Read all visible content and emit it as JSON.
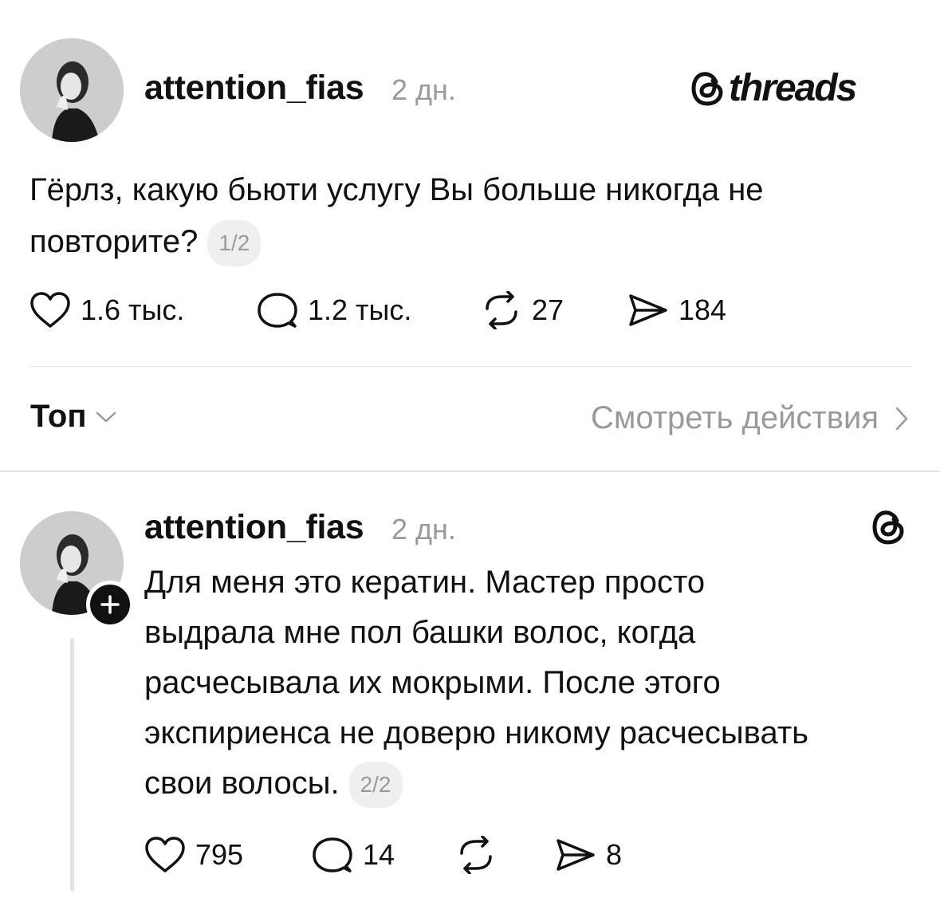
{
  "brand": {
    "wordmark": "threads",
    "icon": "threads-icon"
  },
  "post": {
    "username": "attention_fias",
    "time": "2 дн.",
    "text": "Гёрлз, какую бьюти услугу Вы больше никогда не повторите?",
    "page_badge": "1/2",
    "actions": {
      "likes": "1.6 тыс.",
      "replies": "1.2 тыс.",
      "reposts": "27",
      "shares": "184"
    }
  },
  "sort_bar": {
    "sort_label": "Топ",
    "view_activity_label": "Смотреть действия"
  },
  "reply": {
    "username": "attention_fias",
    "time": "2 дн.",
    "text": "Для меня это кератин. Мастер просто выдрала мне пол башки волос, когда расчесывала их мокрыми. После этого экспириенса не доверю никому расчесывать свои волосы.",
    "page_badge": "2/2",
    "actions": {
      "likes": "795",
      "replies": "14",
      "reposts": "",
      "shares": "8"
    }
  },
  "colors": {
    "text": "#111111",
    "muted": "#9a9a9a",
    "badge_bg": "#efefef",
    "divider": "#e6e6e6"
  }
}
